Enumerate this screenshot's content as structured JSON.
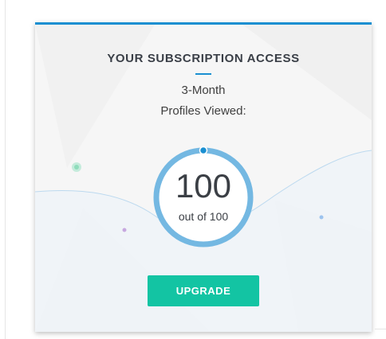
{
  "card": {
    "title": "YOUR SUBSCRIPTION ACCESS",
    "plan": "3-Month",
    "metric_label": "Profiles Viewed:",
    "gauge": {
      "value": "100",
      "subtitle": "out of 100",
      "fraction": 1.0
    },
    "upgrade_label": "UPGRADE"
  },
  "colors": {
    "accent": "#1a8fd1",
    "gauge_ring": "#74b8e2",
    "button": "#13c4a3",
    "text": "#3a3f47"
  }
}
